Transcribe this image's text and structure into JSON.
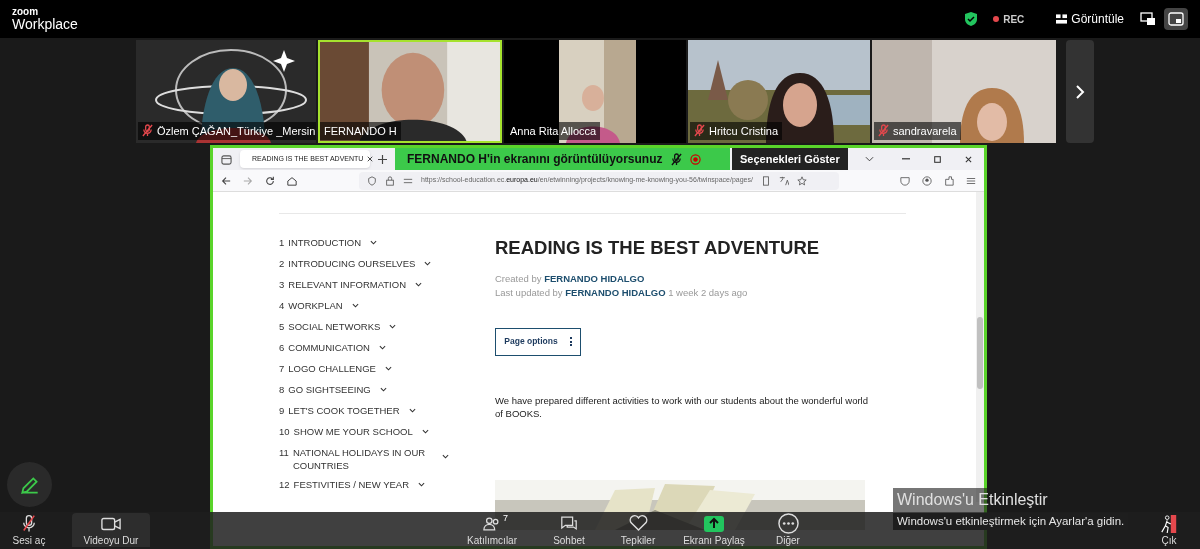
{
  "app": {
    "logo_top": "zoom",
    "logo_bottom": "Workplace",
    "rec": "REC",
    "view_button": "Görüntüle"
  },
  "participants": [
    {
      "name": "Özlem ÇAĞAN_Türkiye _Mersin",
      "muted": true,
      "active": false
    },
    {
      "name": "FERNANDO H",
      "muted": false,
      "active": true
    },
    {
      "name": "Anna Rita Allocca",
      "muted": false,
      "active": false
    },
    {
      "name": "Hritcu Cristina",
      "muted": true,
      "active": false
    },
    {
      "name": "sandravarela",
      "muted": true,
      "active": false
    }
  ],
  "share_banner": {
    "text": "FERNANDO H'in ekranını görüntülüyorsunuz",
    "options": "Seçenekleri Göster"
  },
  "browser": {
    "tab_title": "READING IS THE BEST ADVENTU",
    "url_prefix": "https://school-education.ec.",
    "url_domain": "europa.eu",
    "url_rest": "/en/etwinning/projects/knowing-me-knowing-you-56/twinspace/pages/"
  },
  "page": {
    "nav": [
      {
        "number": "1",
        "label": "INTRODUCTION"
      },
      {
        "number": "2",
        "label": "INTRODUCING OURSELVES"
      },
      {
        "number": "3",
        "label": "RELEVANT INFORMATION"
      },
      {
        "number": "4",
        "label": "WORKPLAN"
      },
      {
        "number": "5",
        "label": "SOCIAL NETWORKS"
      },
      {
        "number": "6",
        "label": "COMMUNICATION"
      },
      {
        "number": "7",
        "label": "LOGO CHALLENGE"
      },
      {
        "number": "8",
        "label": "GO SIGHTSEEING"
      },
      {
        "number": "9",
        "label": "LET'S COOK TOGETHER"
      },
      {
        "number": "10",
        "label": "SHOW ME YOUR SCHOOL"
      },
      {
        "number": "11",
        "label": "NATIONAL HOLIDAYS IN OUR COUNTRIES"
      },
      {
        "number": "12",
        "label": "FESTIVITIES / NEW YEAR"
      }
    ],
    "title": "READING IS THE BEST ADVENTURE",
    "created_label": "Created by",
    "created_author": "FERNANDO HIDALGO",
    "updated_label": "Last updated by",
    "updated_author": "FERNANDO HIDALGO",
    "updated_ago": "1 week 2 days ago",
    "options_button": "Page options",
    "body": "We have prepared different activities to work with our students about the wonderful world of BOOKS."
  },
  "toolbar": [
    {
      "kind": "mic",
      "label": "Sesi aç",
      "muted": true
    },
    {
      "kind": "video",
      "label": "Videoyu Dur"
    },
    {
      "kind": "participants",
      "label": "Katılımcılar",
      "badge": "7"
    },
    {
      "kind": "chat",
      "label": "Sohbet"
    },
    {
      "kind": "reactions",
      "label": "Tepkiler"
    },
    {
      "kind": "share",
      "label": "Ekranı Paylaş"
    },
    {
      "kind": "more",
      "label": "Diğer"
    },
    {
      "kind": "leave",
      "label": "Çık"
    }
  ],
  "os_notice": {
    "title": "Windows'u Etkinleştir",
    "subtitle": "Windows'u etkinleştirmek için Ayarlar'a gidin."
  }
}
